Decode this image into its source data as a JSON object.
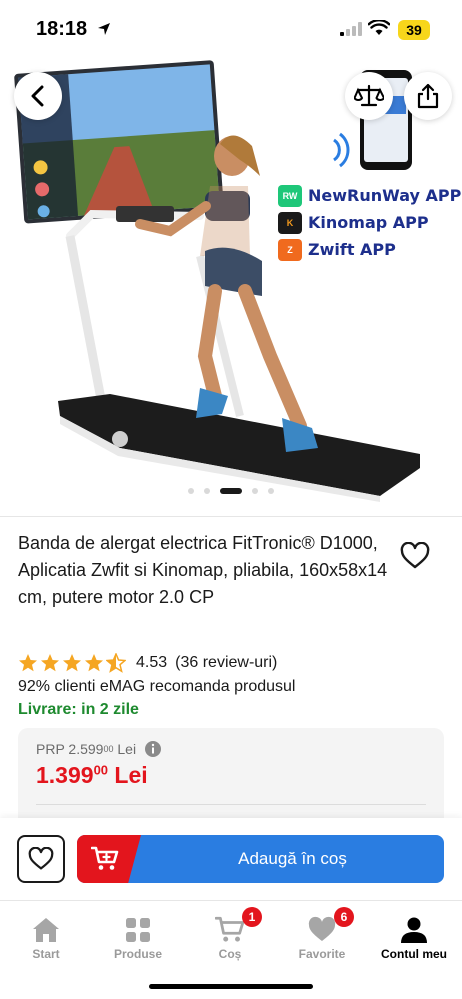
{
  "status_bar": {
    "time": "18:18",
    "battery": "39"
  },
  "product_image": {
    "apps": [
      {
        "name": "NewRunWay APP",
        "logo": "RW",
        "color": "#1ec779"
      },
      {
        "name": "Kinomap APP",
        "logo": "K",
        "color": "#f39a1e"
      },
      {
        "name": "Zwift APP",
        "logo": "Z",
        "color": "#f06a1e"
      }
    ],
    "carousel": {
      "total": 5,
      "active": 2
    }
  },
  "product": {
    "title": "Banda de alergat electrica FitTronic® D1000, Aplicatia Zwfit si Kinomap, pliabila, 160x58x14 cm, putere motor 2.0 CP",
    "rating": "4.53",
    "rating_stars": 4.5,
    "reviews": "(36 review-uri)",
    "recommend": "92% clienti eMAG recomanda produsul",
    "delivery": "Livrare: in 2 zile"
  },
  "price": {
    "prp_label": "PRP 2.599",
    "prp_decimals": "00",
    "prp_currency": "Lei",
    "price_main": "1.399",
    "price_decimals": "00",
    "price_currency": "Lei"
  },
  "actions": {
    "add_to_cart": "Adaugă în coș"
  },
  "tabs": [
    {
      "label": "Start",
      "icon": "home-icon"
    },
    {
      "label": "Produse",
      "icon": "grid-icon"
    },
    {
      "label": "Coș",
      "icon": "cart-icon",
      "badge": "1"
    },
    {
      "label": "Favorite",
      "icon": "heart-icon",
      "badge": "6"
    },
    {
      "label": "Contul meu",
      "icon": "user-icon"
    }
  ],
  "colors": {
    "accent_red": "#e3151d",
    "accent_blue": "#2a7de1",
    "delivery_green": "#1e8a2f",
    "star": "#f5a623"
  }
}
